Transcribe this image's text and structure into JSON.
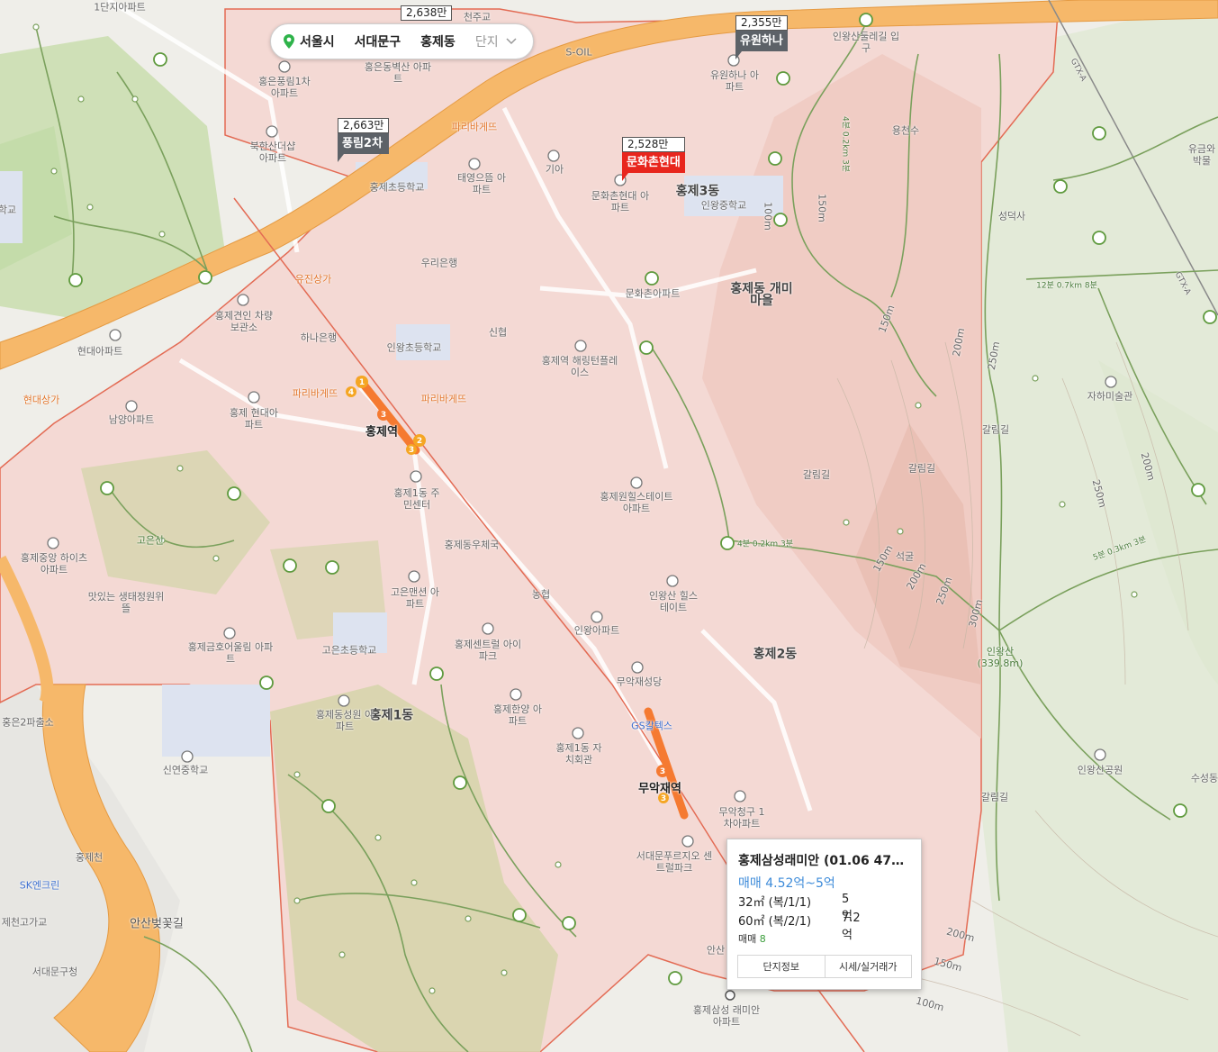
{
  "breadcrumb": {
    "city": "서울시",
    "district": "서대문구",
    "dong": "홍제동",
    "type": "단지"
  },
  "complex_markers": [
    {
      "price": "2,638만",
      "name": ""
    },
    {
      "price": "2,355만",
      "name": "유원하나"
    },
    {
      "price": "2,663만",
      "name": "풍림2차"
    },
    {
      "price": "2,528만",
      "name": "문화촌현대"
    }
  ],
  "districts": [
    "홍제동 개미마을",
    "홍제3동",
    "홍제2동",
    "홍제1동"
  ],
  "stations": [
    "홍제역",
    "무악재역"
  ],
  "labels": {
    "top_left_1": "1단지아파트",
    "cheonjugyo": "천주교",
    "s_oil": "S-OIL",
    "hongeun_pungrim": "홍은풍림1차 아파트",
    "hongeun_byeoksan": "홍은동벽산 아파트",
    "yuwon_hana": "유원하나 아파트",
    "inwangsan_dulle": "인왕산둘레길 입구",
    "bukhansan": "북한산더샵 아파트",
    "paris1": "파리바게뜨",
    "kia": "기아",
    "taeyoung": "태영으뜸 아파트",
    "munhwachon_hyundai": "문화촌현대 아파트",
    "inwang_ms": "인왕중학교",
    "hongje_es": "홍제초등학교",
    "yongcheonsu": "용천수",
    "seongdeoksa": "성덕사",
    "woori": "우리은행",
    "yujin": "유진상가",
    "munhwachon_apt": "문화촌아파트",
    "gyeonin": "홍제견인 차량보관소",
    "hana": "하나은행",
    "shinhyup": "신협",
    "inwang_es": "인왕초등학교",
    "haeringteon": "홍제역 해링턴플레이스",
    "hyundai_apt": "현대아파트",
    "hyundai_mall": "현대상가",
    "paris2": "파리바게뜨",
    "paris3": "파리바게뜨",
    "namyang": "남양아파트",
    "hongje_hyundai": "홍제 현대아파트",
    "jahamisulgwan": "자하미술관",
    "hillstate": "홍제원힐스테이트 아파트",
    "jumin1": "홍제1동 주민센터",
    "goeunsan": "고은산",
    "hongje_post": "홍제동우체국",
    "hongje_jungang": "홍제중앙 하이츠아파트",
    "restaurant": "맛있는 생태정원위뜰",
    "goeun_mansion": "고은맨션 아파트",
    "nonghyup": "농협",
    "inwangsan_hill": "인왕산 힐스테이트",
    "inwang_apt": "인왕아파트",
    "goeun_es": "고은초등학교",
    "sentral": "홍제센트럴 아이파크",
    "golden": "홍제금호어울림 아파트",
    "muak_church": "무악재성당",
    "gs": "GS칼텍스",
    "hongeun2": "홍은2파출소",
    "seongwon": "홍제동성원 아파트",
    "hanyang": "홍제한양 아파트",
    "jachi": "홍제1동 자치회관",
    "sinyeon_ms": "신연중학교",
    "inwangsan_park": "인왕산공원",
    "suseong": "수성동",
    "muak_cheonggu": "무악청구 1차아파트",
    "prugio": "서대문푸르지오 센트럴파크",
    "hongjecheon": "홍제천",
    "sk": "SK엔크린",
    "hongjecheon_elev": "제천고가교",
    "ansan_blossom": "안산벚꽃길",
    "seodaemun_office": "서대문구청",
    "ansan": "안산",
    "raemian": "홍제삼성 래미안아파트",
    "inwangsan": "인왕산 (339.8m)",
    "seokgul": "석굴",
    "galrim1": "갈림길",
    "galrim2": "갈림길",
    "galrim3": "갈림길",
    "galrim4": "갈림길",
    "yugeum": "유금와 박물",
    "hak": "학교",
    "trail1": "4분 0.2km 3분",
    "trail2": "12분 0.7km 8분",
    "trail3": "4분 0.2km 3분",
    "trail4": "5분 0.3km 3분",
    "gtx1": "GTX-A",
    "gtx2": "GTX-A",
    "c100": "100m",
    "c150a": "150m",
    "c150b": "150m",
    "c150c": "150m",
    "c150d": "150m",
    "c200a": "200m",
    "c200b": "200m",
    "c200c": "200m",
    "c250a": "250m",
    "c250b": "250m",
    "c250c": "250m",
    "c300": "300m",
    "c100b": "100m",
    "c150e": "150m",
    "c200d": "200m"
  },
  "popup": {
    "title": "홍제삼성래미안 (01.06 47…",
    "range": "매매 4.52억~5억",
    "rows": [
      {
        "area": "32㎡ (복/1/1)",
        "price": "5억"
      },
      {
        "area": "60㎡ (복/2/1)",
        "price": "7.2억"
      }
    ],
    "count_label": "매매",
    "count": "8",
    "btn_info": "단지정보",
    "btn_price": "시세/실거래가"
  }
}
